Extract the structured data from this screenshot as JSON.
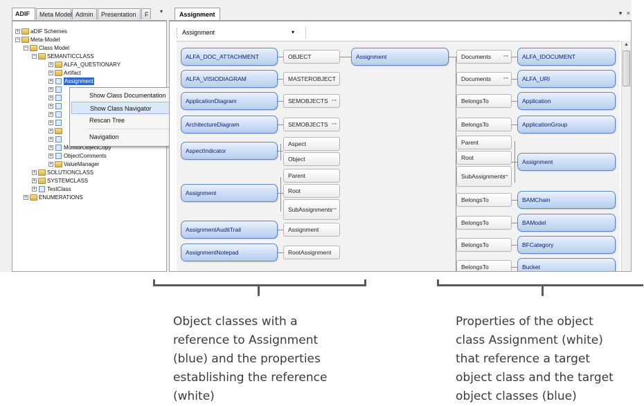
{
  "left_tabs": [
    "ADIF",
    "Meta Model",
    "Admin",
    "Presentation",
    "F"
  ],
  "left_tabs_more": "▾",
  "tree": {
    "nodes": [
      {
        "label": "aDIF Schemes",
        "pm": "+",
        "icon": "folder"
      },
      {
        "label": "Meta-Model",
        "pm": "−",
        "icon": "folder"
      },
      {
        "label": "Class Model",
        "pm": "−",
        "icon": "folder"
      },
      {
        "label": "SEMANTICCLASS",
        "pm": "−",
        "icon": "folder"
      },
      {
        "label": "ALFA_QUESTIONARY",
        "pm": "+",
        "icon": "folder"
      },
      {
        "label": "Artifact",
        "pm": "+",
        "icon": "folder"
      },
      {
        "label": "Assignment",
        "pm": "+",
        "icon": "doc",
        "selected": true
      },
      {
        "label": "MonitorObjectCopy",
        "pm": "+",
        "icon": "doc"
      },
      {
        "label": "ObjectComments",
        "pm": "+",
        "icon": "doc"
      },
      {
        "label": "ValueManager",
        "pm": "+",
        "icon": "folder"
      },
      {
        "label": "SOLUTIONCLASS",
        "pm": "+",
        "icon": "folder"
      },
      {
        "label": "SYSTEMCLASS",
        "pm": "+",
        "icon": "folder"
      },
      {
        "label": "TestClass",
        "pm": "+",
        "icon": "doc"
      },
      {
        "label": "ENUMERATIONS",
        "pm": "+",
        "icon": "folder"
      }
    ]
  },
  "context_menu": {
    "items": [
      "Show Class Documentation",
      "Show Class Navigator",
      "Rescan Tree",
      "Navigation"
    ],
    "submenu_arrow": "▸"
  },
  "right_tab": "Assignment",
  "right_controls": "▾ ×",
  "combo_value": "Assignment",
  "combo_arrow": "▾",
  "connector_glyph": "⊶",
  "navigator": {
    "center": "Assignment",
    "incoming": [
      {
        "class": "ALFA_DOC_ATTACHMENT",
        "props": [
          "OBJECT"
        ]
      },
      {
        "class": "ALFA_VISIODIAGRAM",
        "props": [
          "MASTEROBJECT"
        ]
      },
      {
        "class": "ApplicationDiagram",
        "props": [
          "SEMOBJECTS"
        ]
      },
      {
        "class": "ArchitectureDiagram",
        "props": [
          "SEMOBJECTS"
        ]
      },
      {
        "class": "AspectIndicator",
        "props": [
          "Aspect",
          "Object"
        ]
      },
      {
        "class": "Assignment",
        "props": [
          "Parent",
          "Root",
          "SubAssignments"
        ]
      },
      {
        "class": "AssignmentAuditTrail",
        "props": [
          "Assignment"
        ]
      },
      {
        "class": "AssignmentNotepad",
        "props": [
          "RootAssignment"
        ]
      }
    ],
    "outgoing": [
      {
        "props": [
          "Documents"
        ],
        "class": "ALFA_IDOCUMENT"
      },
      {
        "props": [
          "Documents"
        ],
        "class": "ALFA_URI"
      },
      {
        "props": [
          "BelongsTo"
        ],
        "class": "Application"
      },
      {
        "props": [
          "BelongsTo"
        ],
        "class": "ApplicationGroup"
      },
      {
        "props": [
          "Parent",
          "Root",
          "SubAssignments"
        ],
        "class": "Assignment"
      },
      {
        "props": [
          "BelongsTo"
        ],
        "class": "BAMChain"
      },
      {
        "props": [
          "BelongsTo"
        ],
        "class": "BAModel"
      },
      {
        "props": [
          "BelongsTo"
        ],
        "class": "BFCategory"
      },
      {
        "props": [
          "BelongsTo"
        ],
        "class": "Bucket"
      }
    ]
  },
  "annotations": {
    "left": [
      "Object classes with a",
      "reference to Assignment",
      "(blue) and the properties",
      "establishing the reference",
      "(white)"
    ],
    "right": [
      "Properties of the object",
      "class Assignment (white)",
      "that reference a target",
      "object class and the target",
      "object classes (blue)"
    ]
  },
  "colors": {
    "accent": "#316ac5",
    "class_box": "#b6cdef",
    "property_box": "#ffffff",
    "annotation": "#3b3b3b"
  }
}
